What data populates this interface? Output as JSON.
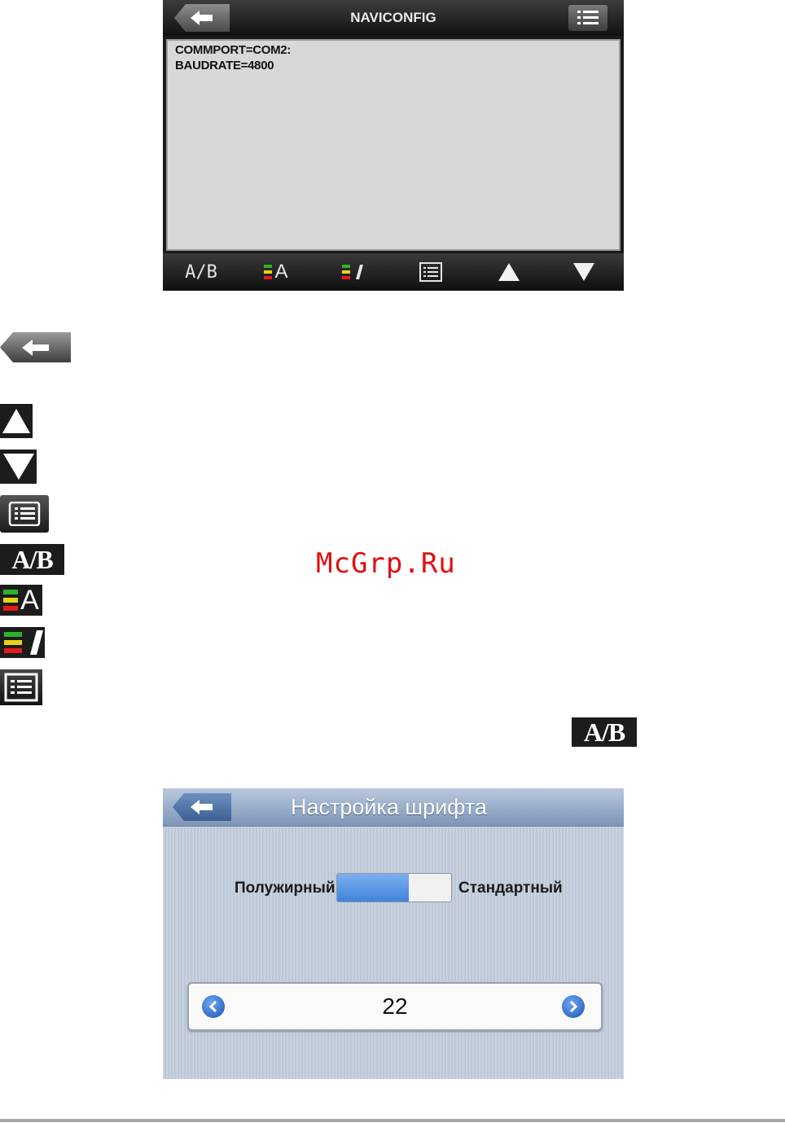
{
  "naviconfig": {
    "title": "NAVICONFIG",
    "lines": [
      "COMMPORT=COM2:",
      "BAUDRATE=4800"
    ],
    "toolbar": {
      "ab_label": "A/B",
      "font_size_label": "A"
    }
  },
  "legend": {
    "ab_label": "A/B",
    "font_size_label": "A"
  },
  "inline_ab_label": "A/B",
  "watermark": "McGrp.Ru",
  "font_settings": {
    "title": "Настройка шрифта",
    "bold_label": "Полужирный",
    "standard_label": "Стандартный",
    "toggle_level": 0.63,
    "font_size_value": "22"
  },
  "colors": {
    "bar_red": "#e31b1b",
    "bar_yellow": "#e8d21a",
    "bar_green": "#2bb42b",
    "watermark": "#e01010",
    "accent_blue": "#3f83de"
  }
}
